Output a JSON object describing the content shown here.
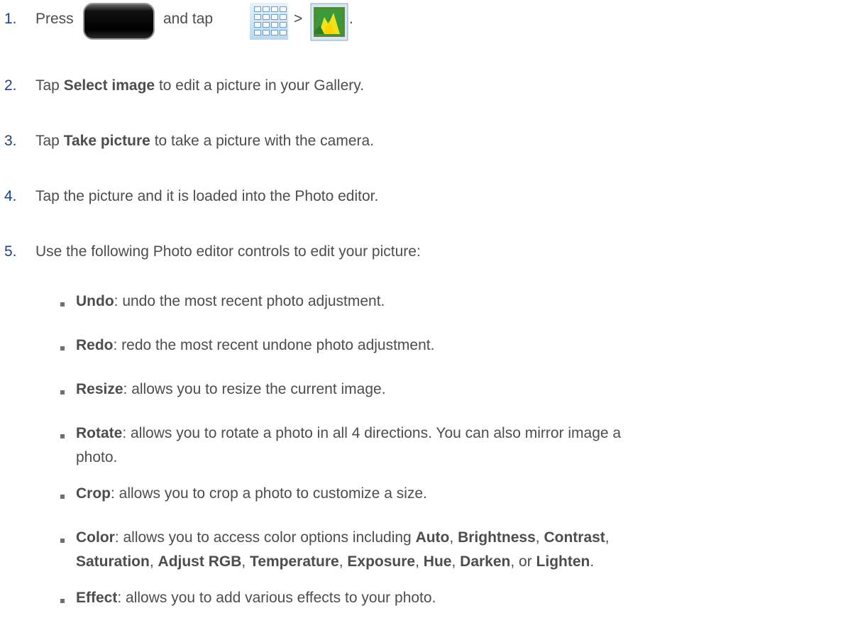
{
  "steps": [
    {
      "num": "1.",
      "press": "Press",
      "and_tap": "and tap",
      "sep": ">",
      "end": "."
    },
    {
      "num": "2.",
      "tap": "Tap",
      "bold": "Select image",
      "rest": "to edit a picture in your Gallery."
    },
    {
      "num": "3.",
      "tap": "Tap",
      "bold": "Take picture",
      "rest": "to take a picture with the camera."
    },
    {
      "num": "4.",
      "text": "Tap the picture and it is loaded into the Photo editor."
    },
    {
      "num": "5.",
      "text": "Use the following Photo editor controls to edit your picture:"
    }
  ],
  "controls": [
    {
      "name": "Undo",
      "desc": ": undo the most recent photo adjustment."
    },
    {
      "name": "Redo",
      "desc": ": redo the most recent undone photo adjustment."
    },
    {
      "name": "Resize",
      "desc": ": allows you to resize the current image."
    },
    {
      "name": "Rotate",
      "desc": ": allows you to rotate a photo in all 4 directions. You can also mirror image a",
      "cont": "photo."
    },
    {
      "name": "Crop",
      "desc": ": allows you to crop a photo to customize a size."
    },
    {
      "name": "Color",
      "desc": ": allows you to access color options including"
    },
    {
      "name": "Effect",
      "desc": ": allows you to add various effects to your photo."
    }
  ],
  "color_options": [
    "Auto",
    "Brightness",
    "Contrast",
    "Saturation",
    "Adjust RGB",
    "Temperature",
    "Exposure",
    "Hue",
    "Darken",
    "Lighten"
  ],
  "punct": {
    "comma": ",",
    "or": ", or",
    "period": "."
  },
  "icons": {
    "home_key": "home-key-icon",
    "apps": "apps-grid-icon",
    "photo_editor": "photo-editor-icon"
  }
}
